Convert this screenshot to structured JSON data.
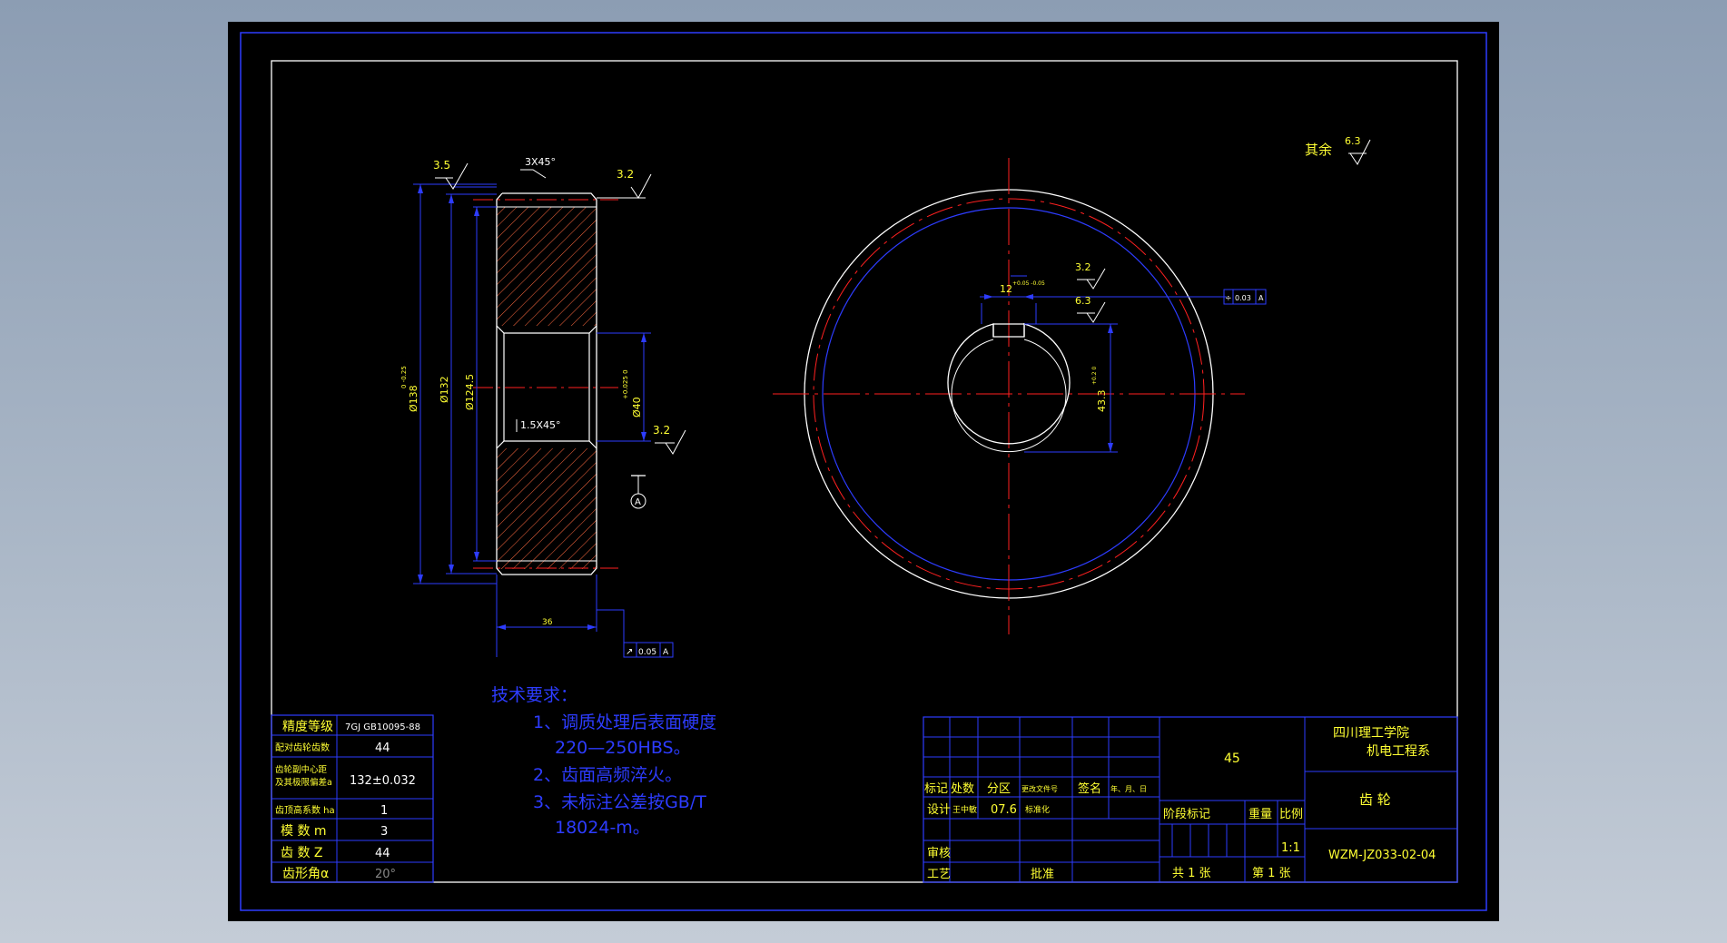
{
  "note_other": {
    "label": "其余",
    "roughness": "6.3"
  },
  "left_view": {
    "chamfer_top": "3X45°",
    "roughness_left_top": "3.5",
    "roughness_right_top": "3.2",
    "roughness_bore": "3.2",
    "dim_outer": "Ø138",
    "dim_outer_tol": "0\n-0.25",
    "dim_pitch": "Ø132",
    "dim_root": "Ø124.5",
    "dim_bore": "Ø40",
    "dim_bore_tol": "+0.025\n0",
    "chamfer_bore": "1.5X45°",
    "datum": "A",
    "dim_width": "36",
    "runout": {
      "symbol": "↗",
      "value": "0.05",
      "datum": "A"
    }
  },
  "right_view": {
    "keyway_width": "12",
    "keyway_tol": "+0.05\n-0.05",
    "keyway_depth": "43.3",
    "keyway_depth_tol": "+0.2\n0",
    "roughness_key1": "3.2",
    "roughness_key2": "6.3",
    "symmetry": {
      "symbol": "÷",
      "value": "0.03",
      "datum": "A"
    }
  },
  "tech_req": {
    "title": "技术要求：",
    "lines": [
      "1、调质处理后表面硬度",
      "220—250HBS。",
      "2、齿面高频淬火。",
      "3、未标注公差按GB/T",
      "18024-m。"
    ]
  },
  "params": [
    {
      "label": "精度等级",
      "value": "7GJ GB10095-88"
    },
    {
      "label": "配对齿轮齿数",
      "value": "44"
    },
    {
      "label": "齿轮副中心距及其极限偏差a",
      "value": "132±0.032"
    },
    {
      "label": "齿顶高系数 ha",
      "value": "1"
    },
    {
      "label": "模  数 m",
      "value": "3"
    },
    {
      "label": "齿  数 Z",
      "value": "44"
    },
    {
      "label": "齿形角α",
      "value": "20°"
    }
  ],
  "title_block": {
    "material": "45",
    "school": "四川理工学院",
    "dept": "机电工程系",
    "part_name": "齿 轮",
    "drawing_no": "WZM-JZ033-02-04",
    "scale": "1:1",
    "header": [
      "标记",
      "处数",
      "分区",
      "更改文件号",
      "签名",
      "年、月、日"
    ],
    "design": "设计",
    "designer": "王中敏",
    "date": "07.6",
    "std": "标准化",
    "review": "审核",
    "process": "工艺",
    "approve": "批准",
    "stage": "阶段标记",
    "weight": "重量",
    "ratio": "比例",
    "sheets_total": "共 1 张",
    "sheet_no": "第 1 张"
  },
  "colors": {
    "frame": "#2d3cff",
    "outline": "#ffffff",
    "center": "#ff2020",
    "text_yellow": "#ffff33"
  }
}
